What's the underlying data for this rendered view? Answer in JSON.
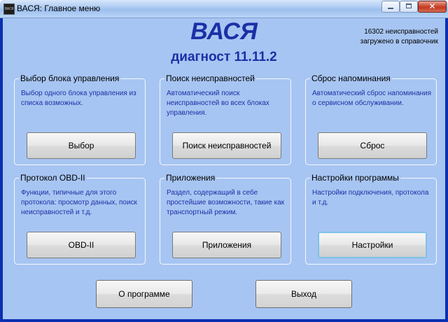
{
  "window": {
    "title": "ВАСЯ:  Главное меню",
    "icon": "app-icon",
    "close_glyph": "✕"
  },
  "header": {
    "app_name": "ВАСЯ",
    "version": "диагност 11.11.2",
    "info_line1": "16302 неисправностей",
    "info_line2": "загружено в справочник"
  },
  "groups": [
    {
      "title": "Выбор блока управления",
      "description": "Выбор одного блока управления из списка возможных.",
      "button": "Выбор"
    },
    {
      "title": "Поиск неисправностей",
      "description": "Автоматический поиск неисправностей во всех блоках управления.",
      "button": "Поиск неисправностей"
    },
    {
      "title": "Сброс напоминания",
      "description": "Автоматический сброс напоминания о сервисном обслуживании.",
      "button": "Сброс"
    },
    {
      "title": "Протокол OBD-II",
      "description": "Функции, типичные для этого протокола: просмотр данных, поиск неисправностей и т.д.",
      "button": "OBD-II"
    },
    {
      "title": "Приложения",
      "description": "Раздел, содержащий в себе простейшие возможности, такие как транспортный режим.",
      "button": "Приложения"
    },
    {
      "title": "Настройки программы",
      "description": "Настройки подключения, протокола и т.д.",
      "button": "Настройки"
    }
  ],
  "footer": {
    "about_button": "О программе",
    "exit_button": "Выход"
  },
  "colors": {
    "client_bg": "#a7c5f2",
    "accent_text": "#1c2fa6"
  }
}
